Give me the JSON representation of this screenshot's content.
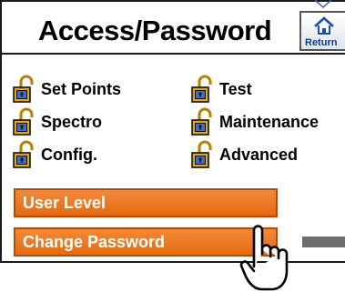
{
  "title": "Access/Password",
  "return_button": {
    "label": "Return",
    "icon": "home-icon"
  },
  "access_items": [
    {
      "label": "Set Points",
      "icon": "padlock-open-icon"
    },
    {
      "label": "Test",
      "icon": "padlock-open-icon"
    },
    {
      "label": "Spectro",
      "icon": "padlock-open-icon"
    },
    {
      "label": "Maintenance",
      "icon": "padlock-open-icon"
    },
    {
      "label": "Config.",
      "icon": "padlock-open-icon"
    },
    {
      "label": "Advanced",
      "icon": "padlock-open-icon"
    }
  ],
  "buttons": {
    "user_level": "User Level",
    "change_password": "Change Password"
  },
  "colors": {
    "button_orange": "#e8741f",
    "button_border": "#b14b05",
    "lock_gold": "#e0a622",
    "lock_body_blue": "#3d6fc7",
    "return_blue": "#0c3b9c"
  }
}
